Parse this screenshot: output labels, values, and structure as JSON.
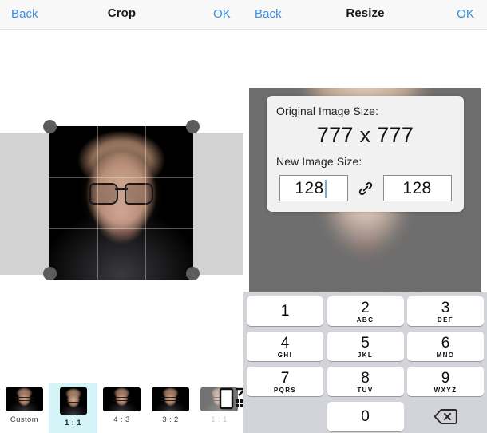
{
  "left_pane": {
    "navbar": {
      "back_label": "Back",
      "title": "Crop",
      "ok_label": "OK"
    },
    "ratio_strip": {
      "items": [
        {
          "label": "Custom",
          "selected": false,
          "faded": false
        },
        {
          "label": "1 : 1",
          "selected": true,
          "faded": false
        },
        {
          "label": "4 : 3",
          "selected": false,
          "faded": false
        },
        {
          "label": "3 : 2",
          "selected": false,
          "faded": false
        },
        {
          "label": "1 : 1",
          "selected": false,
          "faded": true
        }
      ]
    }
  },
  "right_pane": {
    "navbar": {
      "back_label": "Back",
      "title": "Resize",
      "ok_label": "OK"
    },
    "dialog": {
      "original_label": "Original Image Size:",
      "original_value": "777 x 777",
      "new_label": "New Image Size:",
      "width_value": "128",
      "height_value": "128",
      "link_icon": "link-chain-icon",
      "link_locked": true
    },
    "keypad": {
      "keys": [
        {
          "digit": "1",
          "letters": ""
        },
        {
          "digit": "2",
          "letters": "ABC"
        },
        {
          "digit": "3",
          "letters": "DEF"
        },
        {
          "digit": "4",
          "letters": "GHI"
        },
        {
          "digit": "5",
          "letters": "JKL"
        },
        {
          "digit": "6",
          "letters": "MNO"
        },
        {
          "digit": "7",
          "letters": "PQRS"
        },
        {
          "digit": "8",
          "letters": "TUV"
        },
        {
          "digit": "9",
          "letters": "WXYZ"
        },
        {
          "digit": "0",
          "letters": ""
        }
      ],
      "delete_icon": "backspace-delete-icon"
    }
  },
  "colors": {
    "accent_blue": "#3b8ee0",
    "navbar_bg": "#f8f8f8",
    "crop_backdrop": "#d2d2d2",
    "resize_backdrop": "#6e6e6e",
    "keypad_bg": "#d2d4da",
    "selected_highlight": "#d4f4f8",
    "handle_gray": "#5c5c5c"
  }
}
